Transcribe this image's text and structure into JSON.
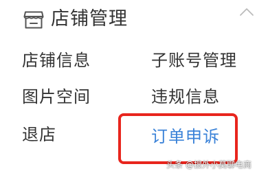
{
  "header": {
    "title": "店铺管理",
    "store_icon": "storefront-icon",
    "collapse_icon": "chevron-up-icon"
  },
  "menu": {
    "items": [
      {
        "label": "店铺信息"
      },
      {
        "label": "子账号管理"
      },
      {
        "label": "图片空间"
      },
      {
        "label": "违规信息"
      },
      {
        "label": "退店"
      },
      {
        "label": "订单申诉",
        "state": "active"
      }
    ]
  },
  "watermark": "头条 @搜外小莫聊电商",
  "colors": {
    "text": "#333333",
    "active": "#3a82d8",
    "highlight": "#e8251d",
    "icon": "#555555"
  }
}
